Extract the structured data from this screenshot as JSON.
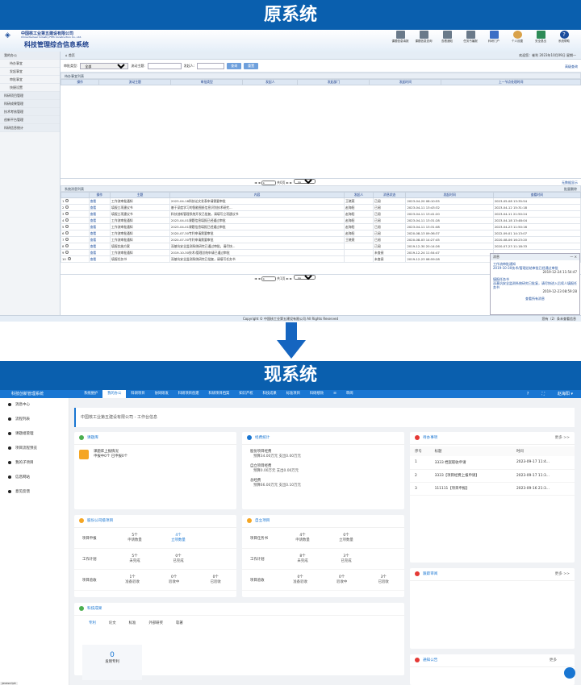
{
  "banners": {
    "old": "原系统",
    "new": "现系统"
  },
  "old": {
    "company": "中国核工业第五建设有限公司",
    "company_en": "China Nuclear Industry Fifth Construction Co., Ltd.",
    "system_title": "科技管理综合信息系统",
    "tools": [
      "课题信息填报",
      "课题信息查询",
      "查看通知",
      "任务书编报",
      "科研门户",
      "个人设置",
      "安全退出",
      "系统帮助"
    ],
    "nav": [
      {
        "label": "我的办公",
        "type": "grp"
      },
      {
        "label": "待办事宜",
        "type": "sub"
      },
      {
        "label": "发起事宜",
        "type": "sub"
      },
      {
        "label": "审批事宜",
        "type": "sub"
      },
      {
        "label": "快捷设置",
        "type": "sub"
      },
      {
        "label": "科研项目管理",
        "type": "grp"
      },
      {
        "label": "科研成果管理",
        "type": "grp"
      },
      {
        "label": "技术考核管理",
        "type": "grp"
      },
      {
        "label": "创新平台管理",
        "type": "grp"
      },
      {
        "label": "科研信息统计",
        "type": "grp"
      }
    ],
    "breadcrumb": "首页",
    "welcome": "欢迎您：崔利    2023年10月09日 星期一",
    "filter": {
      "type_label": "审批类型:",
      "type_value": "全部",
      "topic_label": "流动主题:",
      "sender_label": "发起人:",
      "query": "查询",
      "reset": "重置",
      "advanced": "高级查询"
    },
    "pending_title": "待办事宜列表",
    "pending_cols": [
      "操作",
      "流动主题",
      "审批类型",
      "发起人",
      "发起部门",
      "发起时间",
      "上一节点处理时间"
    ],
    "pager": {
      "page": "1",
      "of": "共0页",
      "size": "30",
      "none": "无数据显示"
    },
    "msg_title": "系统消息列表",
    "batch_delete": "批量删除",
    "msg_cols": [
      "",
      "操作",
      "主题",
      "内容",
      "发起人",
      "消息状态",
      "发起时间",
      "查看时间"
    ],
    "msg_rows": [
      {
        "no": "1",
        "op": "查看",
        "subject": "工作流审批通知",
        "content": "2023-04-18科技论文发表申请需要审批",
        "sender": "王晓燕",
        "status": "已阅",
        "time": "2023-04-20 08:10:55",
        "read": "2023-05-08 13:35:54"
      },
      {
        "no": "2",
        "op": "查看",
        "subject": "填报立项建议书",
        "content": "基于深度学习的智能图纸信息识别技术研究...",
        "sender": "赵海阳",
        "status": "已阅",
        "time": "2023-04-11 13:43:32",
        "read": "2023-04-12 15:31:18"
      },
      {
        "no": "3",
        "op": "查看",
        "subject": "填报立项建议书",
        "content": "科技创新管理系统开发已批复，请填写立项建议书",
        "sender": "赵海阳",
        "status": "已阅",
        "time": "2023-04-11 13:41:20",
        "read": "2023-04-11 21:50:24"
      },
      {
        "no": "4",
        "op": "查看",
        "subject": "工作流审批通知",
        "content": "2023-04-01课题信息填报已经通过审批",
        "sender": "赵海阳",
        "status": "已阅",
        "time": "2023-04-11 13:31:28",
        "read": "2023-04-18 13:48:04"
      },
      {
        "no": "5",
        "op": "查看",
        "subject": "工作流审批通知",
        "content": "2023-04-01课题信息填报已经通过审批",
        "sender": "赵海阳",
        "status": "已阅",
        "time": "2023-04-11 13:31:08",
        "read": "2023-04-23 11:50:16"
      },
      {
        "no": "6",
        "op": "查看",
        "subject": "工作流审批通知",
        "content": "2020-07-30专利申请需要审批",
        "sender": "赵海阳",
        "status": "已阅",
        "time": "2020-08-13 09:36:37",
        "read": "2022-09-01 14:13:07"
      },
      {
        "no": "7",
        "op": "查看",
        "subject": "工作流审批通知",
        "content": "2020-07-30专利申请需要审批",
        "sender": "王晓燕",
        "status": "已阅",
        "time": "2020-08-03 14:27:45",
        "read": "2020-08-06 16:23:20"
      },
      {
        "no": "8",
        "op": "查看",
        "subject": "填报实施方案",
        "content": "深基坑安全监测系统研究已通过审批，请尽快...",
        "sender": "",
        "status": "已阅",
        "time": "2019-12-30 20:14:26",
        "read": "2020-07-23 11:18:33"
      },
      {
        "no": "9",
        "op": "查看",
        "subject": "工作流审批通知",
        "content": "2019-10-30技术/管理总结申请已通过审批",
        "sender": "",
        "status": "未查阅",
        "time": "2019-12-24 11:54:47",
        "read": ""
      },
      {
        "no": "10",
        "op": "查看",
        "subject": "填报任务书",
        "content": "深基坑安全监测系统研究已批复，请填写任务书",
        "sender": "",
        "status": "未查阅",
        "time": "2019-12-23 08:59:28",
        "read": ""
      }
    ],
    "popup": {
      "title": "消息",
      "items": [
        {
          "link": "工作流审批通知",
          "text": "2019-10-30技术/管理总结审批已经通过审批",
          "time": "2019-12-24 11:54:47"
        },
        {
          "link": "填报任务书",
          "text": "深基坑安全监测系统研究已批复，请尽快进入后续人填报任务书",
          "time": "2019-12-23 08:59:28"
        }
      ],
      "all": "查看所有消息"
    },
    "footer": "Copyright © 中国核工业第五建设有限公司 All Rights Reserved",
    "footer_right": "您有（2）条未查看信息"
  },
  "new": {
    "brand": "科技创新管理系统",
    "menu": [
      "系统维护",
      "我的办公",
      "科研项目",
      "协同研发",
      "科研项目创建",
      "科研项目档案",
      "知识产权",
      "科技成果",
      "标准项目",
      "科研绩效",
      "",
      "审阅"
    ],
    "active_menu": "我的办公",
    "user": "赵海阳",
    "sidebar": [
      "消息中心",
      "流程列表",
      "课题组管理",
      "项目流程预览",
      "我的子项目",
      "信息网站",
      "意见反馈"
    ],
    "breadcrumb": "中国核工业第五建设有限公司 - 工作台信息",
    "project_lib": {
      "title": "课题库",
      "item": "课题库上报情况",
      "sub": "申报中0个  已申报0个"
    },
    "funding": {
      "title": "经费统计",
      "items": [
        {
          "t": "股份项目经费",
          "s": "预算34.00万元  支出0.00万元"
        },
        {
          "t": "自立项目经费",
          "s": "预算0.00万元  支出0.00万元"
        },
        {
          "t": "总经费",
          "s": "预算66.00万元  支出0.10万元"
        }
      ]
    },
    "todo": {
      "title": "待办事项",
      "more": "更多 >>",
      "cols": [
        "序号",
        "标题",
        "时间"
      ],
      "rows": [
        {
          "no": "1",
          "title": "3333 档案取收申请",
          "time": "2023-09-17 11:4..."
        },
        {
          "no": "2",
          "title": "3333【项目经费上报申请】",
          "time": "2023-09-17 11:3..."
        },
        {
          "no": "3",
          "title": "111111【项目申报】",
          "time": "2023-09-16 21:3..."
        }
      ]
    },
    "share_proj": {
      "title": "股份公司级项目",
      "rows": [
        {
          "label": "项目申报",
          "cells": [
            {
              "v": "5个",
              "t": "申请数量"
            },
            {
              "v": "4个",
              "t": "立项数量",
              "blue": true
            }
          ]
        },
        {
          "label": "工作计划",
          "cells": [
            {
              "v": "5个",
              "t": "未完成"
            },
            {
              "v": "0个",
              "t": "已完成"
            }
          ]
        },
        {
          "label": "项目验收",
          "cells": [
            {
              "v": "1个",
              "t": "准备验收"
            },
            {
              "v": "0个",
              "t": "验收中"
            },
            {
              "v": "0个",
              "t": "已验收"
            }
          ]
        }
      ]
    },
    "self_proj": {
      "title": "自立项目",
      "rows": [
        {
          "label": "项目任务书",
          "cells": [
            {
              "v": "4个",
              "t": "申请数量"
            },
            {
              "v": "0个",
              "t": "立项数量"
            }
          ]
        },
        {
          "label": "工作计划",
          "cells": [
            {
              "v": "8个",
              "t": "未完成"
            },
            {
              "v": "3个",
              "t": "已完成"
            }
          ]
        },
        {
          "label": "项目验收",
          "cells": [
            {
              "v": "0个",
              "t": "准备验收"
            },
            {
              "v": "0个",
              "t": "验收中"
            },
            {
              "v": "3个",
              "t": "已验收"
            }
          ]
        }
      ]
    },
    "sci": {
      "title": "科技成果",
      "tabs": [
        "专利",
        "论文",
        "标准",
        "外部研奖",
        "软著"
      ],
      "count": "0",
      "count_label": "发明专利"
    },
    "review": {
      "title": "跟踪审阅",
      "more": "更多 >>"
    },
    "notice": {
      "title": "通知公告",
      "more": "更多"
    },
    "status_bar": "javascript:"
  },
  "colors": {
    "banner": "#0a5fae",
    "new_primary": "#1976d2"
  }
}
